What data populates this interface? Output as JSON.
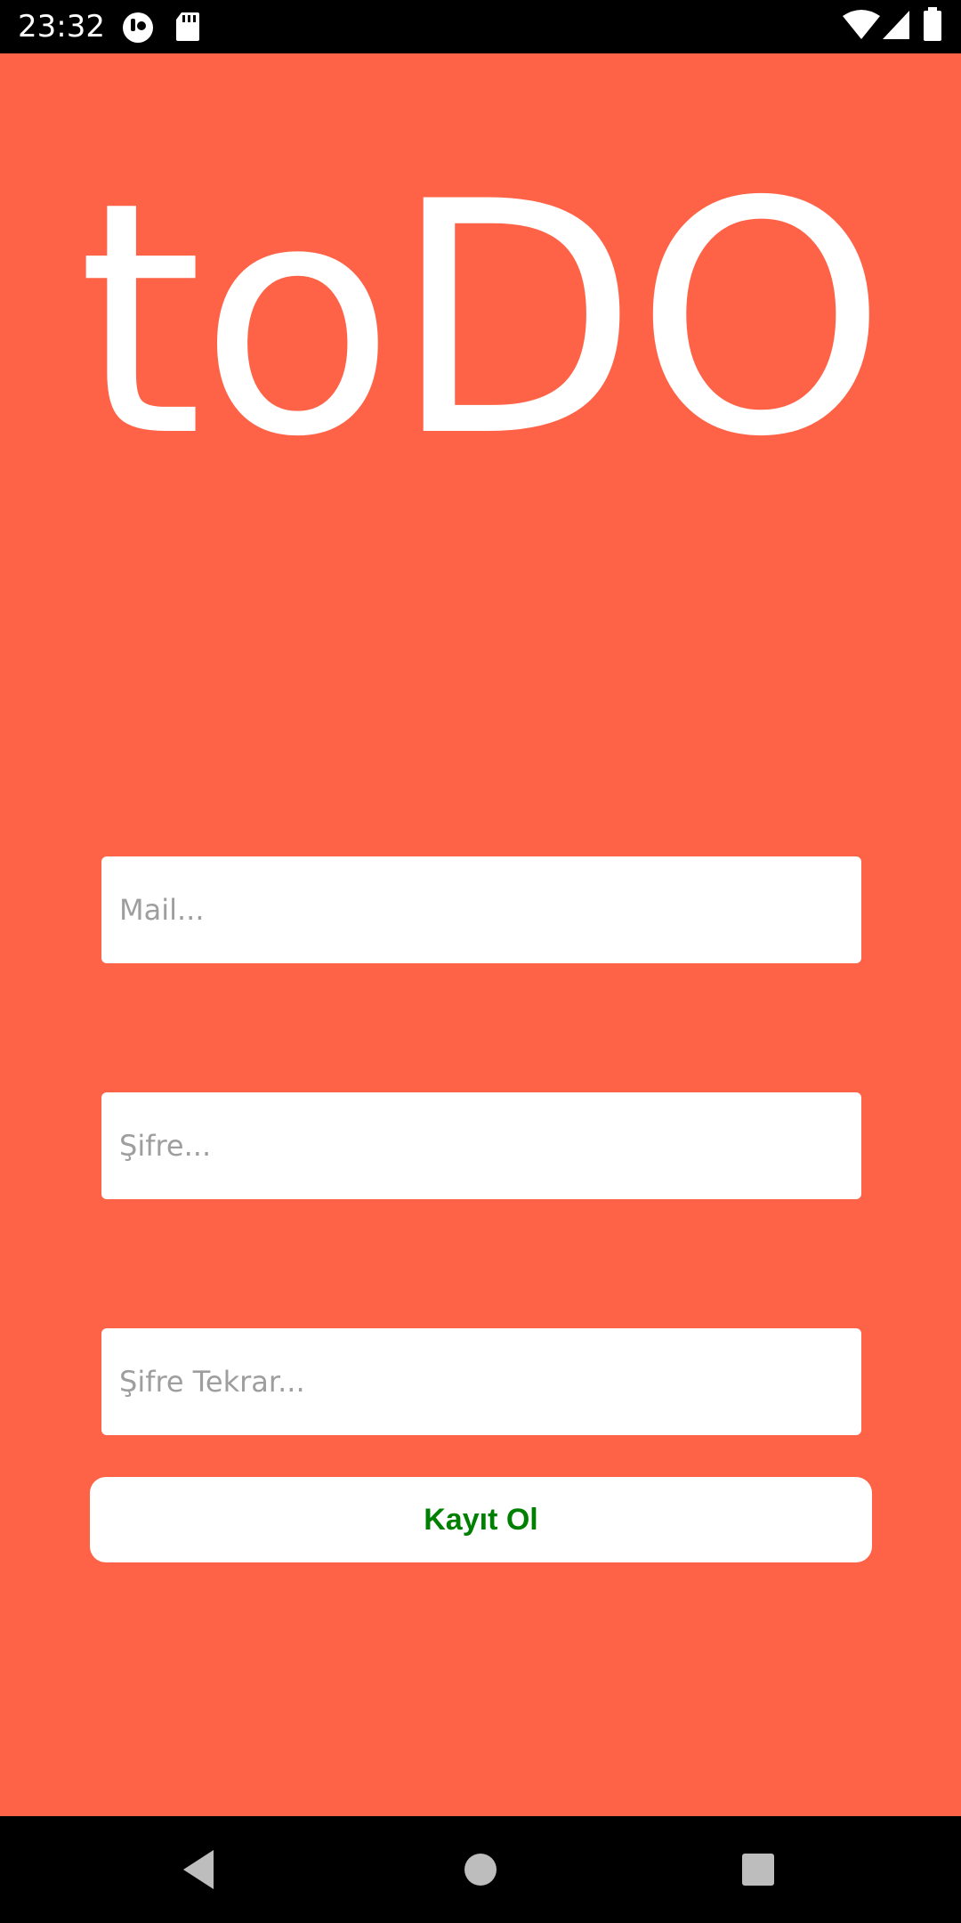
{
  "status_bar": {
    "time": "23:32",
    "icons": [
      "assistant-icon",
      "sd-card-icon",
      "wifi-icon",
      "cell-signal-icon",
      "battery-icon"
    ]
  },
  "app": {
    "title": "toDO"
  },
  "form": {
    "mail_placeholder": "Mail...",
    "password_placeholder": "Şifre...",
    "password_repeat_placeholder": "Şifre Tekrar...",
    "submit_label": "Kayıt Ol"
  },
  "nav_bar": {
    "buttons": [
      "back-icon",
      "home-icon",
      "recents-icon"
    ]
  },
  "colors": {
    "background": "#ff6347",
    "button_text": "#008000",
    "field_background": "#ffffff",
    "bars": "#000000"
  }
}
